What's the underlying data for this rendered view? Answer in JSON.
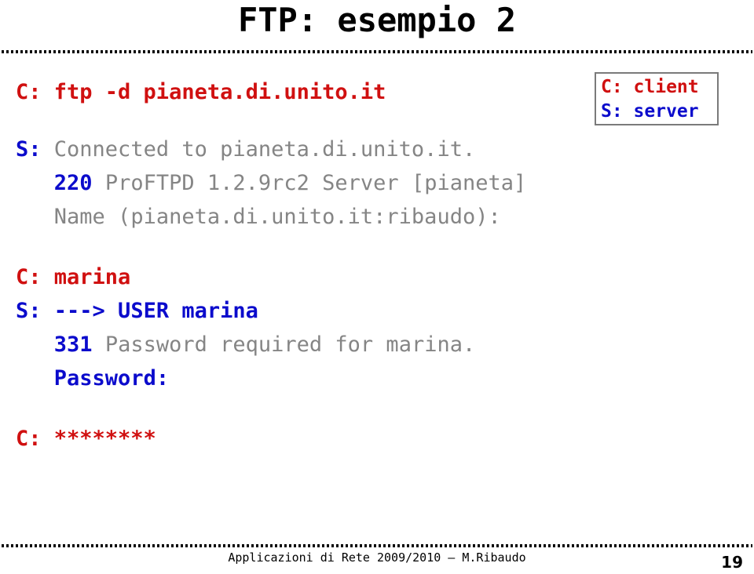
{
  "slide": {
    "title": "FTP: esempio 2",
    "page_number": "19"
  },
  "legend": {
    "client": "C: client",
    "server": "S: server",
    "client_color": "#D01010",
    "server_color": "#0B0BCC",
    "border_color": "#7a7a7a"
  },
  "transcript": {
    "client_command": "C: ftp -d pianeta.di.unito.it",
    "server_block": {
      "prefix": "S: ",
      "connected": "Connected to pianeta.di.unito.it.",
      "code_220": "220",
      "banner": " ProFTPD 1.2.9rc2 Server [pianeta]",
      "name_prompt": "Name (pianeta.di.unito.it:ribaudo):"
    },
    "client_user": "C: marina",
    "server_user_block": {
      "prefix": "S: ",
      "user_echo": "---> USER marina",
      "code_331": "331",
      "password_required": " Password required for marina.",
      "password_prompt": "Password:"
    },
    "client_password": "C: ********"
  },
  "footer": {
    "text": "Applicazioni di Rete 2009/2010 – M.Ribaudo"
  }
}
